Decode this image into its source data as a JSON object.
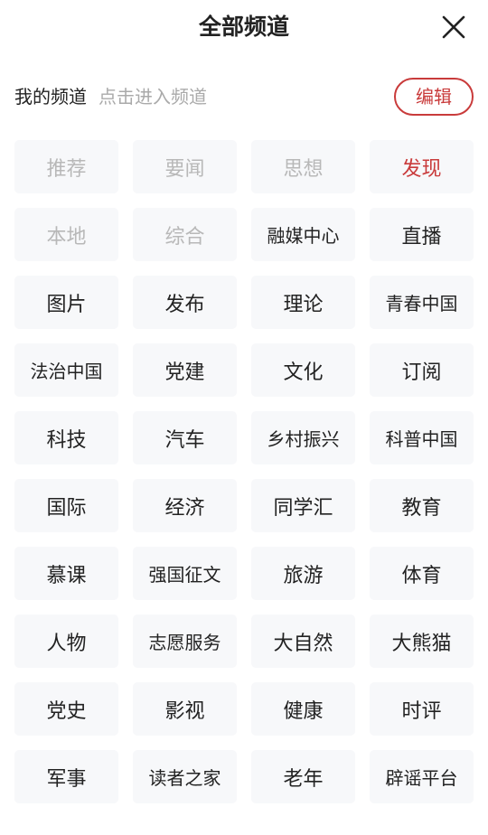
{
  "header": {
    "title": "全部频道"
  },
  "my_channels": {
    "label": "我的频道",
    "hint": "点击进入频道",
    "edit_label": "编辑"
  },
  "colors": {
    "accent": "#c93b3b",
    "fixed": "#b8b8b8",
    "chip_bg": "#f7f8fa"
  },
  "channels": [
    {
      "label": "推荐",
      "state": "fixed"
    },
    {
      "label": "要闻",
      "state": "fixed"
    },
    {
      "label": "思想",
      "state": "fixed"
    },
    {
      "label": "发现",
      "state": "active"
    },
    {
      "label": "本地",
      "state": "fixed"
    },
    {
      "label": "综合",
      "state": "fixed"
    },
    {
      "label": "融媒中心",
      "state": "normal"
    },
    {
      "label": "直播",
      "state": "normal"
    },
    {
      "label": "图片",
      "state": "normal"
    },
    {
      "label": "发布",
      "state": "normal"
    },
    {
      "label": "理论",
      "state": "normal"
    },
    {
      "label": "青春中国",
      "state": "normal"
    },
    {
      "label": "法治中国",
      "state": "normal"
    },
    {
      "label": "党建",
      "state": "normal"
    },
    {
      "label": "文化",
      "state": "normal"
    },
    {
      "label": "订阅",
      "state": "normal"
    },
    {
      "label": "科技",
      "state": "normal"
    },
    {
      "label": "汽车",
      "state": "normal"
    },
    {
      "label": "乡村振兴",
      "state": "normal"
    },
    {
      "label": "科普中国",
      "state": "normal"
    },
    {
      "label": "国际",
      "state": "normal"
    },
    {
      "label": "经济",
      "state": "normal"
    },
    {
      "label": "同学汇",
      "state": "normal"
    },
    {
      "label": "教育",
      "state": "normal"
    },
    {
      "label": "慕课",
      "state": "normal"
    },
    {
      "label": "强国征文",
      "state": "normal"
    },
    {
      "label": "旅游",
      "state": "normal"
    },
    {
      "label": "体育",
      "state": "normal"
    },
    {
      "label": "人物",
      "state": "normal"
    },
    {
      "label": "志愿服务",
      "state": "normal"
    },
    {
      "label": "大自然",
      "state": "normal"
    },
    {
      "label": "大熊猫",
      "state": "normal"
    },
    {
      "label": "党史",
      "state": "normal"
    },
    {
      "label": "影视",
      "state": "normal"
    },
    {
      "label": "健康",
      "state": "normal"
    },
    {
      "label": "时评",
      "state": "normal"
    },
    {
      "label": "军事",
      "state": "normal"
    },
    {
      "label": "读者之家",
      "state": "normal"
    },
    {
      "label": "老年",
      "state": "normal"
    },
    {
      "label": "辟谣平台",
      "state": "normal"
    }
  ]
}
